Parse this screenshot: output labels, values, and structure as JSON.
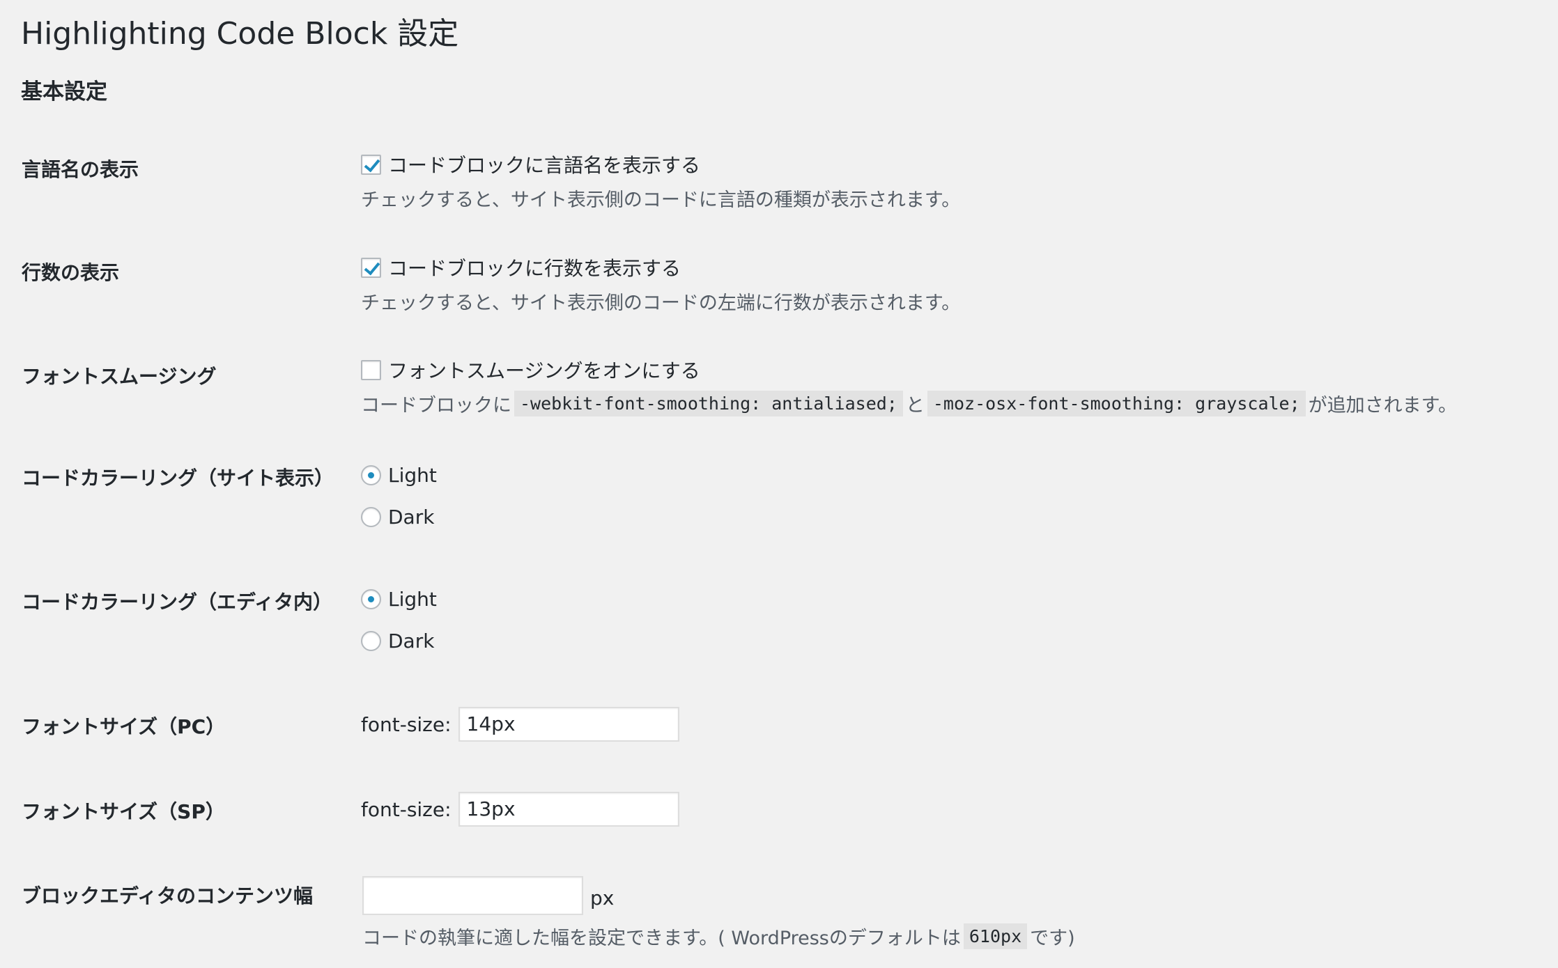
{
  "header": {
    "title": "Highlighting Code Block 設定",
    "section": "基本設定"
  },
  "settings": {
    "lang_name": {
      "label": "言語名の表示",
      "checkbox_label": "コードブロックに言語名を表示する",
      "checked": true,
      "description": "チェックすると、サイト表示側のコードに言語の種類が表示されます。"
    },
    "line_numbers": {
      "label": "行数の表示",
      "checkbox_label": "コードブロックに行数を表示する",
      "checked": true,
      "description": "チェックすると、サイト表示側のコードの左端に行数が表示されます。"
    },
    "font_smoothing": {
      "label": "フォントスムージング",
      "checkbox_label": "フォントスムージングをオンにする",
      "checked": false,
      "desc_prefix": "コードブロックに",
      "code_1": "-webkit-font-smoothing: antialiased;",
      "desc_mid": "と",
      "code_2": "-moz-osx-font-smoothing: grayscale;",
      "desc_suffix": "が追加されます。"
    },
    "coloring_front": {
      "label": "コードカラーリング（サイト表示）",
      "options": [
        "Light",
        "Dark"
      ],
      "selected": "Light"
    },
    "coloring_editor": {
      "label": "コードカラーリング（エディタ内）",
      "options": [
        "Light",
        "Dark"
      ],
      "selected": "Light"
    },
    "font_size_pc": {
      "label": "フォントサイズ（PC）",
      "prefix": "font-size:",
      "value": "14px"
    },
    "font_size_sp": {
      "label": "フォントサイズ（SP）",
      "prefix": "font-size:",
      "value": "13px"
    },
    "content_width": {
      "label": "ブロックエディタのコンテンツ幅",
      "value": "",
      "unit": "px",
      "desc_prefix": "コードの執筆に適した幅を設定できます。( WordPressのデフォルトは",
      "code": "610px",
      "desc_suffix": "です)"
    }
  },
  "colors": {
    "background": "#f1f1f1",
    "accent": "#1e8cbe",
    "text": "#23282d",
    "description": "#555d66",
    "code_bg": "#e2e2e2"
  },
  "icons": {
    "checked_checkbox": "check-mark-icon",
    "selected_radio": "radio-dot-icon"
  }
}
